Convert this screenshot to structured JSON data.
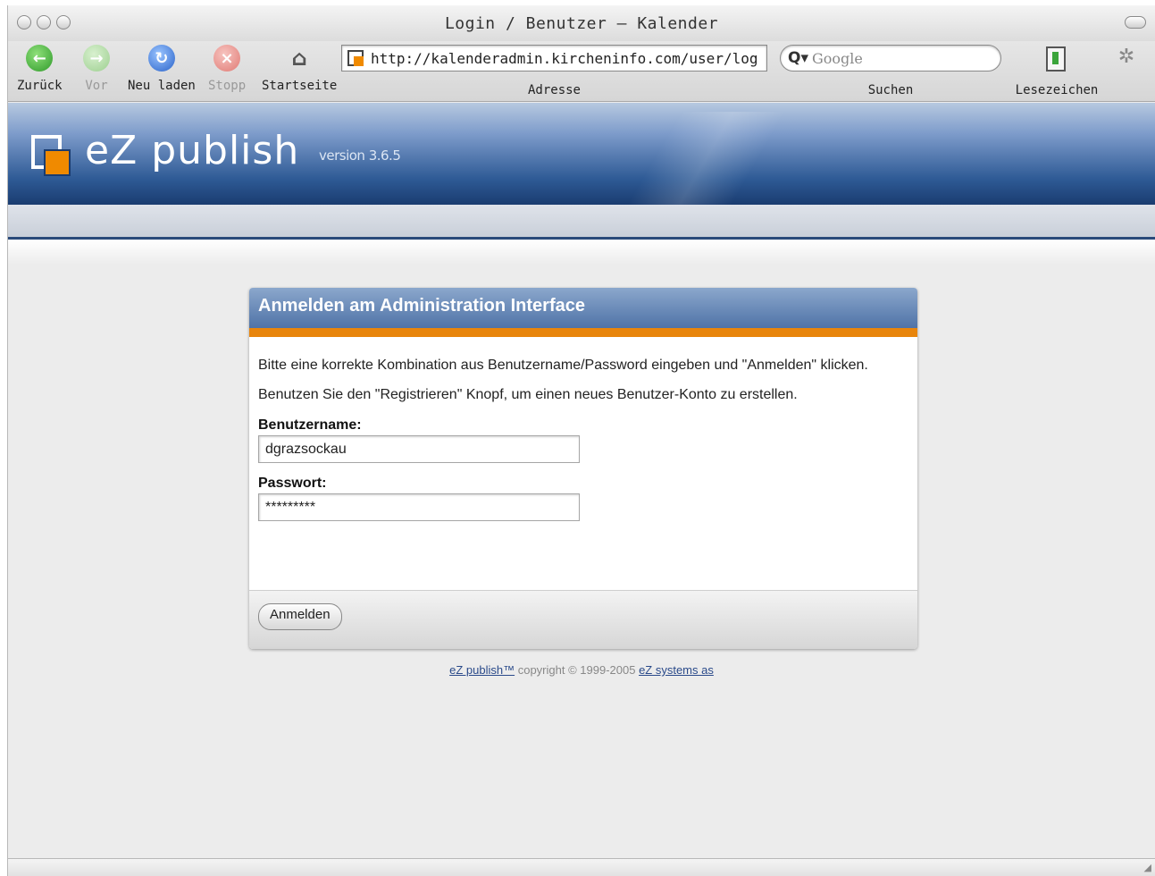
{
  "browser": {
    "window_title": "Login / Benutzer – Kalender",
    "toolbar": {
      "back_label": "Zurück",
      "forward_label": "Vor",
      "reload_label": "Neu laden",
      "stop_label": "Stopp",
      "home_label": "Startseite",
      "address_label": "Adresse",
      "search_label": "Suchen",
      "bookmarks_label": "Lesezeichen"
    },
    "address": "http://kalenderadmin.kircheninfo.com/user/log",
    "search_placeholder": "Google"
  },
  "header": {
    "brand": "eZ publish",
    "version": "version 3.6.5"
  },
  "login": {
    "title": "Anmelden am Administration Interface",
    "intro_line1": "Bitte eine korrekte Kombination aus Benutzername/Password eingeben und \"Anmelden\" klicken.",
    "intro_line2": "Benutzen Sie den \"Registrieren\" Knopf, um einen neues Benutzer-Konto zu erstellen.",
    "username_label": "Benutzername:",
    "username_value": "dgrazsockau",
    "password_label": "Passwort:",
    "password_value": "*********",
    "submit_label": "Anmelden"
  },
  "footer": {
    "product_link": "eZ publish™",
    "copyright": " copyright © 1999-2005 ",
    "company_link": "eZ systems as"
  },
  "colors": {
    "accent_orange": "#e8850c",
    "header_blue": "#2e5a95",
    "link_blue": "#2a4a8a"
  }
}
